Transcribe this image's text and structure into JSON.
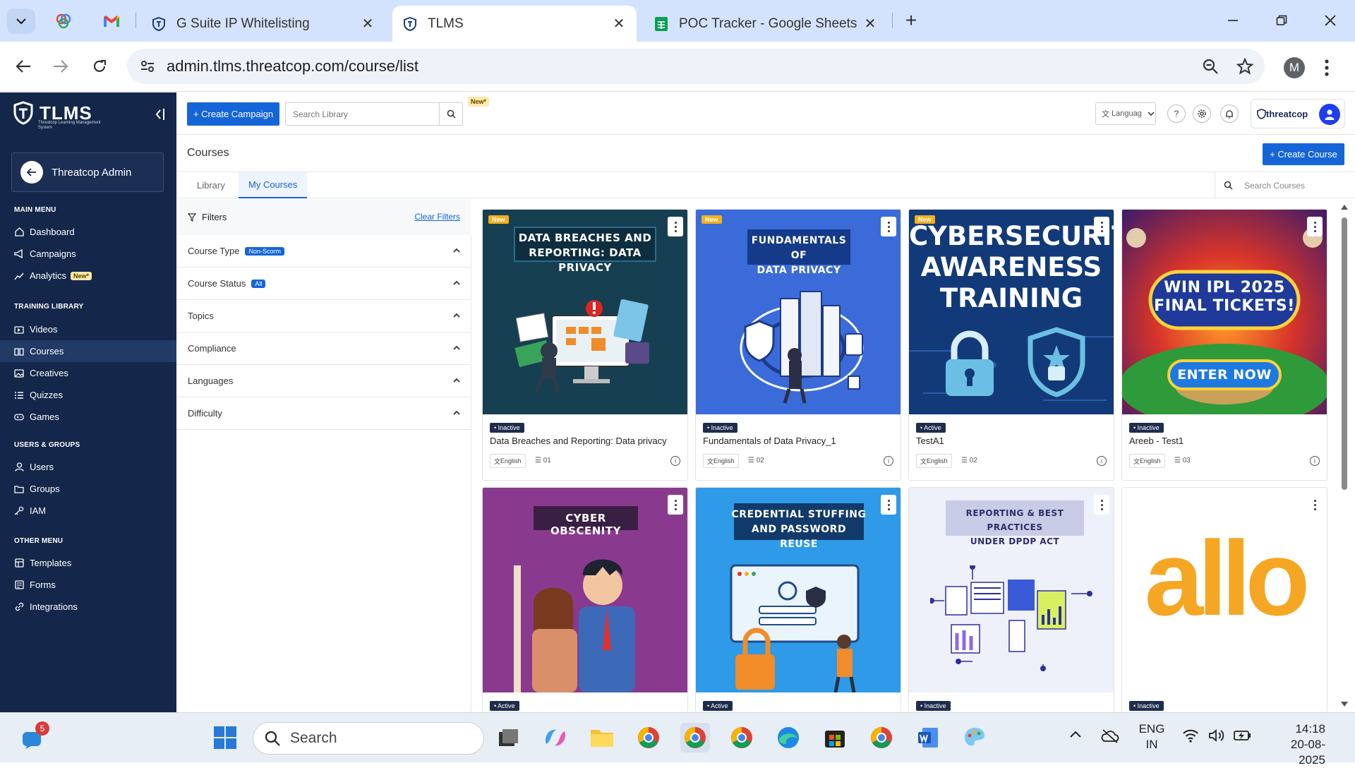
{
  "browser": {
    "tabs": [
      {
        "label": "G Suite IP Whitelisting",
        "icon": "tlms-shield-icon"
      },
      {
        "label": "TLMS",
        "icon": "tlms-shield-icon",
        "active": true
      },
      {
        "label": "POC Tracker - Google Sheets",
        "icon": "sheets-icon"
      }
    ],
    "url": "admin.tlms.threatcop.com/course/list",
    "profile_initial": "M"
  },
  "sidebar": {
    "brand": "TLMS",
    "brand_sub": "Threatcop Learning Management System",
    "admin_name": "Threatcop Admin",
    "sections": {
      "main": "MAIN MENU",
      "training": "TRAINING LIBRARY",
      "users": "USERS & GROUPS",
      "other": "OTHER MENU"
    },
    "items": {
      "dashboard": "Dashboard",
      "campaigns": "Campaigns",
      "analytics": "Analytics",
      "analytics_badge": "New*",
      "videos": "Videos",
      "courses": "Courses",
      "creatives": "Creatives",
      "quizzes": "Quizzes",
      "games": "Games",
      "users": "Users",
      "groups": "Groups",
      "iam": "IAM",
      "templates": "Templates",
      "forms": "Forms",
      "integrations": "Integrations"
    }
  },
  "toolbar": {
    "create_campaign": "+ Create Campaign",
    "search_placeholder": "Search Library",
    "new_badge": "New*",
    "language": "Languag",
    "help": "?",
    "org_logo": "threatcop"
  },
  "content": {
    "title": "Courses",
    "create_course": "+ Create Course",
    "tabs": [
      "Library",
      "My Courses"
    ],
    "search_courses": "Search Courses"
  },
  "filters": {
    "heading": "Filters",
    "clear": "Clear Filters",
    "rows": {
      "course_type": "Course Type",
      "course_type_badge": "Non-Scorm",
      "course_status": "Course Status",
      "course_status_badge": "All",
      "topics": "Topics",
      "compliance": "Compliance",
      "languages": "Languages",
      "difficulty": "Difficulty"
    }
  },
  "cards": [
    {
      "title": "Data Breaches and Reporting: Data privacy",
      "status": "Inactive",
      "lang": "English",
      "count": "01",
      "new": "New",
      "thumb_text": [
        "DATA BREACHES AND",
        "REPORTING: DATA PRIVACY"
      ]
    },
    {
      "title": "Fundamentals of Data Privacy_1",
      "status": "Inactive",
      "lang": "English",
      "count": "02",
      "new": "New",
      "thumb_text": [
        "FUNDAMENTALS OF",
        "DATA PRIVACY"
      ]
    },
    {
      "title": "TestA1",
      "status": "Active",
      "lang": "English",
      "count": "02",
      "new": "New",
      "thumb_text": [
        "CYBERSECURITY",
        "AWARENESS",
        "TRAINING"
      ]
    },
    {
      "title": "Areeb - Test1",
      "status": "Inactive",
      "lang": "English",
      "count": "03",
      "thumb_text": [
        "WIN IPL 2025",
        "FINAL TICKETS!",
        "ENTER NOW"
      ]
    },
    {
      "status": "Active",
      "thumb_text": [
        "CYBER OBSCENITY"
      ]
    },
    {
      "status": "Active",
      "thumb_text": [
        "CREDENTIAL STUFFING",
        "AND PASSWORD REUSE"
      ]
    },
    {
      "status": "Inactive",
      "thumb_text": [
        "REPORTING & BEST PRACTICES",
        "UNDER DPDP ACT"
      ]
    },
    {
      "status": "Inactive",
      "thumb_text": [
        "allo"
      ]
    }
  ],
  "taskbar": {
    "search": "Search",
    "notif_count": "5",
    "lang1": "ENG",
    "lang2": "IN",
    "time": "14:18",
    "date": "20-08-2025"
  },
  "colors": {
    "sidebar_bg": "#14274a",
    "accent": "#1565d8",
    "tabbar": "#d3e3fd"
  }
}
